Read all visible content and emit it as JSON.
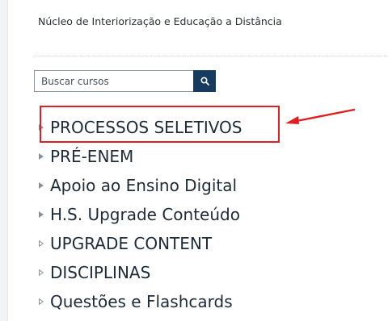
{
  "header": {
    "org_name": "Núcleo de Interiorização e Educação a Distância"
  },
  "search": {
    "placeholder": "Buscar cursos",
    "button_icon": "search-icon"
  },
  "course_categories": [
    {
      "label": "PROCESSOS SELETIVOS",
      "caret": "filled"
    },
    {
      "label": "PRÉ-ENEM",
      "caret": "filled"
    },
    {
      "label": "Apoio ao Ensino Digital",
      "caret": "filled"
    },
    {
      "label": "H.S. Upgrade Conteúdo",
      "caret": "filled"
    },
    {
      "label": "UPGRADE CONTENT",
      "caret": "outline"
    },
    {
      "label": "DISCIPLINAS",
      "caret": "outline"
    },
    {
      "label": "Questões e Flashcards",
      "caret": "outline"
    }
  ],
  "annotation": {
    "color": "#e02020"
  },
  "colors": {
    "search_button": "#173b5e",
    "text": "#1d2b38"
  }
}
